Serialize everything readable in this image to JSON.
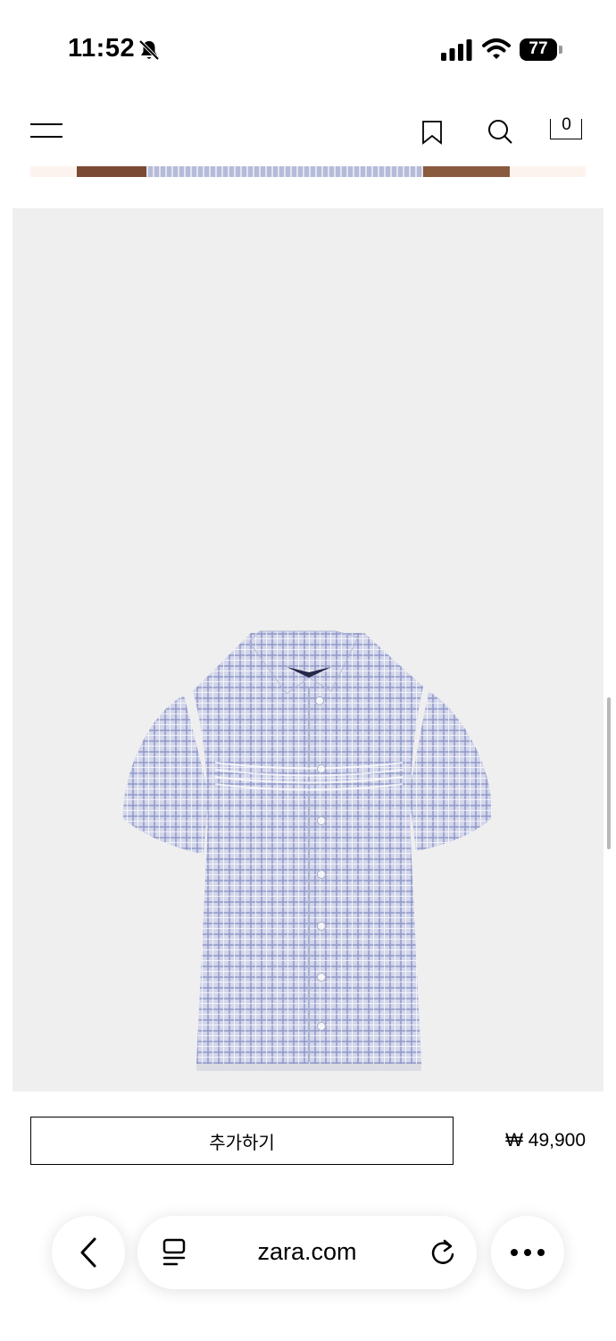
{
  "status_bar": {
    "time": "11:52",
    "battery": "77"
  },
  "header": {
    "cart_count": "0"
  },
  "product": {
    "add_button_label": "추가하기",
    "price": "₩ 49,900"
  },
  "browser": {
    "url": "zara.com"
  },
  "icons": {
    "silent": "bell-slash-icon",
    "signal": "cellular-signal-icon",
    "wifi": "wifi-icon",
    "battery": "battery-icon",
    "menu": "hamburger-menu-icon",
    "bookmark": "bookmark-icon",
    "search": "search-icon",
    "bag": "shopping-bag-icon",
    "back": "chevron-left-icon",
    "tabs": "tab-overview-icon",
    "reload": "reload-icon",
    "more": "ellipsis-icon"
  },
  "colors": {
    "product_background": "#efeff0",
    "shirt_base": "#c7cbe3"
  }
}
